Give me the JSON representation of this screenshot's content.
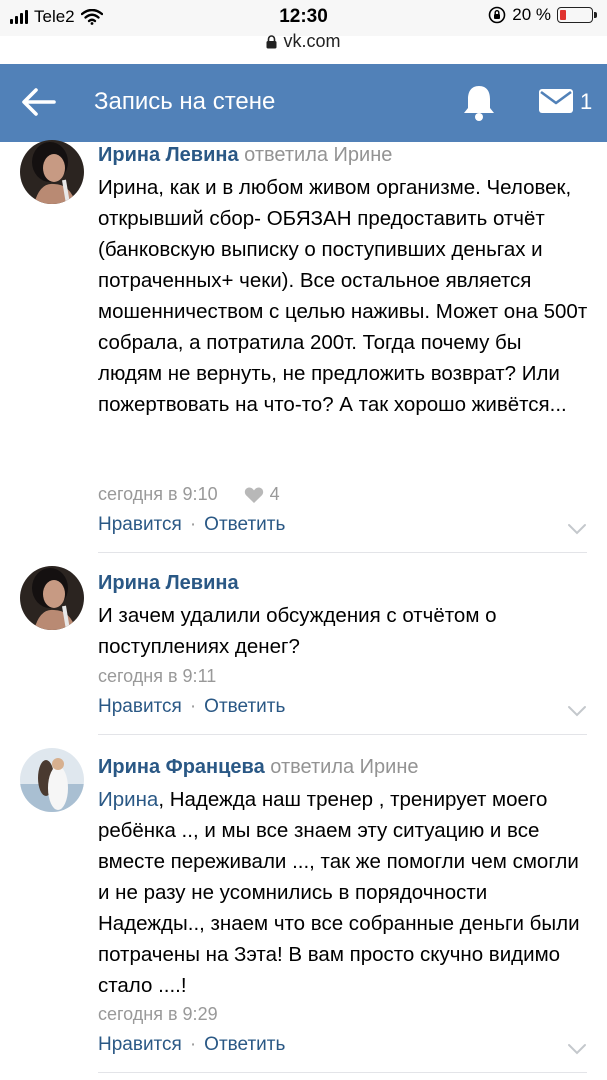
{
  "status_bar": {
    "carrier": "Tele2",
    "time": "12:30",
    "battery": "20 %",
    "battery_level": 0.2
  },
  "browser": {
    "url": "vk.com"
  },
  "header": {
    "title": "Запись на стене",
    "mail_count": "1",
    "accent": "#5181b8"
  },
  "comments": [
    {
      "author": "Ирина Левина",
      "reply_to": "ответила Ирине",
      "text": "Ирина, как и в любом живом организме. Человек, открывший сбор- ОБЯЗАН предоставить отчёт (банковскую выписку о поступивших деньгах и потраченных+ чеки). Все остальное является мошенничеством с целью наживы. Может она 500т собрала, а потратила 200т. Тогда почему бы людям не вернуть, не предложить возврат? Или пожертвовать на что-то? А так хорошо живётся...",
      "time": "сегодня в 9:10",
      "likes": "4",
      "like_label": "Нравится",
      "reply_label": "Ответить"
    },
    {
      "author": "Ирина Левина",
      "text": "И зачем удалили обсуждения с отчётом о поступлениях денег?",
      "time": "сегодня в 9:11",
      "like_label": "Нравится",
      "reply_label": "Ответить"
    },
    {
      "author": "Ирина Францева",
      "reply_to": "ответила Ирине",
      "mention": "Ирина",
      "text": ", Надежда наш тренер , тренирует моего ребёнка .., и мы все знаем эту ситуацию и все вместе переживали ..., так же помогли чем смогли и не разу не усомнились в порядочности Надежды.., знаем что все собранные деньги были потрачены на Зэта! В вам просто скучно видимо стало ....!",
      "time": "сегодня в 9:29",
      "like_label": "Нравится",
      "reply_label": "Ответить"
    }
  ]
}
